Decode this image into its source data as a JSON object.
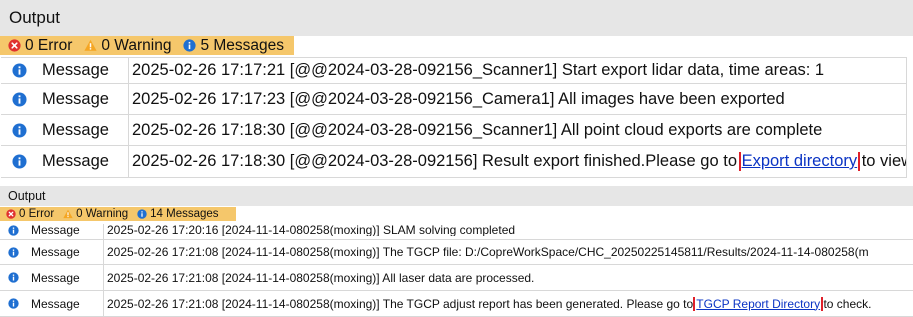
{
  "colors": {
    "error": "#e0312f",
    "warning": "#f5a623",
    "info": "#1f6fd1",
    "highlight": "#f5c76b",
    "link_box": "#e0202a"
  },
  "panel1": {
    "title": "Output",
    "filters": {
      "error": "0 Error",
      "warning": "0 Warning",
      "messages": "5 Messages"
    },
    "rows": [
      {
        "type": "Message",
        "icon": "info-icon",
        "text": "2025-02-26 17:17:21 [@@2024-03-28-092156_Scanner1] Start export lidar data, time areas: 1"
      },
      {
        "type": "Message",
        "icon": "info-icon",
        "text": "2025-02-26 17:17:23 [@@2024-03-28-092156_Camera1] All images have been exported"
      },
      {
        "type": "Message",
        "icon": "info-icon",
        "text": "2025-02-26 17:18:30 [@@2024-03-28-092156_Scanner1] All point cloud exports are complete"
      },
      {
        "type": "Message",
        "icon": "info-icon",
        "text_before": "2025-02-26 17:18:30 [@@2024-03-28-092156] Result export finished.Please go to ",
        "link": "Export directory",
        "text_after": " to view!"
      }
    ]
  },
  "panel2": {
    "title": "Output",
    "filters": {
      "error": "0 Error",
      "warning": "0 Warning",
      "messages": "14 Messages"
    },
    "rows": [
      {
        "type": "Message",
        "icon": "info-icon",
        "text": "2025-02-26 17:20:16 [2024-11-14-080258(moxing)] SLAM solving completed"
      },
      {
        "type": "Message",
        "icon": "info-icon",
        "text": "2025-02-26 17:21:08 [2024-11-14-080258(moxing)] The TGCP file: D:/CopreWorkSpace/CHC_20250225145811/Results/2024-11-14-080258(m"
      },
      {
        "type": "Message",
        "icon": "info-icon",
        "text": "2025-02-26 17:21:08 [2024-11-14-080258(moxing)] All laser data are processed."
      },
      {
        "type": "Message",
        "icon": "info-icon",
        "text_before": "2025-02-26 17:21:08 [2024-11-14-080258(moxing)] The TGCP adjust report has been generated. Please go to ",
        "link": "TGCP Report Directory",
        "text_after": " to check."
      }
    ]
  }
}
